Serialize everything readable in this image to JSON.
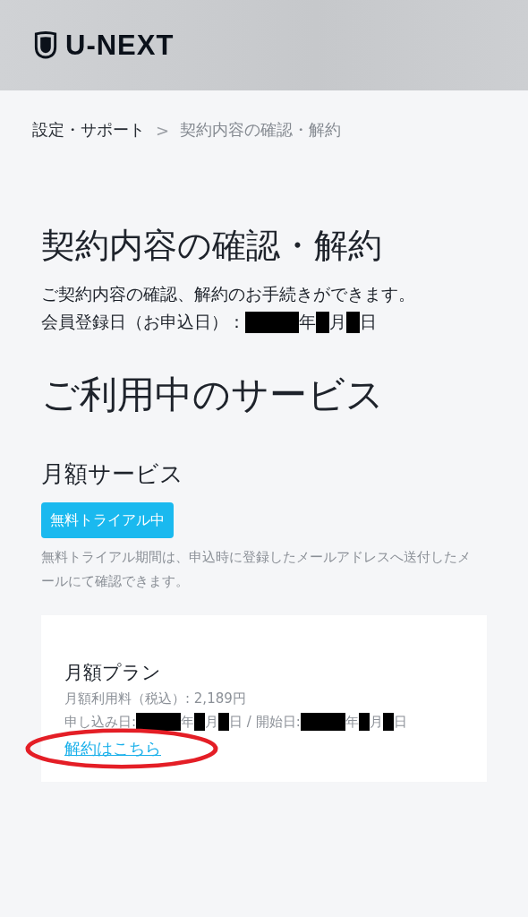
{
  "header": {
    "logo": "U-NEXT"
  },
  "breadcrumb": {
    "items": [
      {
        "label": "設定・サポート",
        "current": false
      },
      {
        "label": "契約内容の確認・解約",
        "current": true
      }
    ],
    "separator": ">"
  },
  "page_title": "契約内容の確認・解約",
  "description": "ご契約内容の確認、解約のお手続きができます。",
  "registration": {
    "label": "会員登録日（お申込日）：",
    "date_parts": [
      {
        "kind": "wide"
      },
      {
        "kind": "text",
        "text": "年"
      },
      {
        "kind": "narrow"
      },
      {
        "kind": "text",
        "text": "月"
      },
      {
        "kind": "narrow"
      },
      {
        "kind": "text",
        "text": "日"
      }
    ]
  },
  "services_title": "ご利用中のサービス",
  "monthly": {
    "title": "月額サービス",
    "badge": "無料トライアル中",
    "note": "無料トライアル期間は、申込時に登録したメールアドレスへ送付したメールにて確認できます。",
    "plan": {
      "name": "月額プラン",
      "fee": "月額利用料（税込）: 2,189円",
      "dates": [
        {
          "kind": "text",
          "text": "申し込み日: "
        },
        {
          "kind": "wide"
        },
        {
          "kind": "text",
          "text": "年"
        },
        {
          "kind": "narrow"
        },
        {
          "kind": "text",
          "text": "月"
        },
        {
          "kind": "narrow"
        },
        {
          "kind": "text",
          "text": "日 / 開始日: "
        },
        {
          "kind": "wide"
        },
        {
          "kind": "text",
          "text": "年"
        },
        {
          "kind": "narrow"
        },
        {
          "kind": "text",
          "text": "月"
        },
        {
          "kind": "narrow"
        },
        {
          "kind": "text",
          "text": "日"
        }
      ],
      "cancel_link": "解約はこちら",
      "highlighted": true
    }
  }
}
